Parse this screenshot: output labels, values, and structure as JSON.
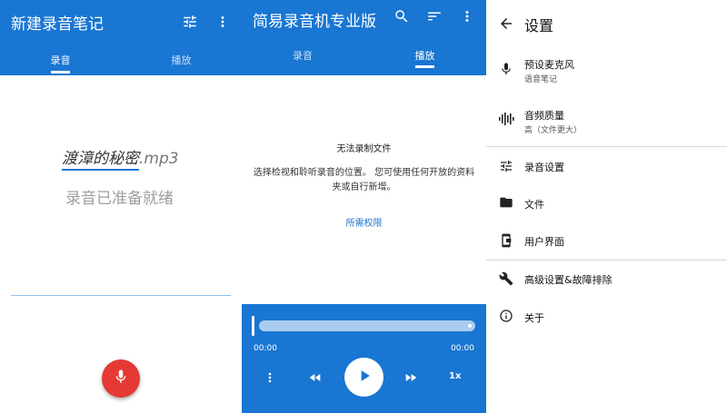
{
  "colors": {
    "primary": "#1976d2",
    "record_fab": "#e53935",
    "divider_accent": "#90c2ec"
  },
  "recorder": {
    "title": "新建录音笔记",
    "actions": [
      "tune-icon",
      "more-vert-icon"
    ],
    "tabs": [
      {
        "label": "录音",
        "active": true
      },
      {
        "label": "播放",
        "active": false
      }
    ],
    "filename_name": "渡漳的秘密",
    "filename_ext": ".mp3",
    "status": "录音已准备就绪",
    "fab_icon": "mic-icon"
  },
  "player_app": {
    "title": "简易录音机专业版",
    "actions": [
      "search-icon",
      "sort-icon",
      "more-vert-icon"
    ],
    "tabs": [
      {
        "label": "录音",
        "active": false
      },
      {
        "label": "播放",
        "active": true
      }
    ],
    "error_title": "无法录制文件",
    "error_desc": "选择检视和聆听录音的位置。 您可使用任何开放的资料夹或自行新增。",
    "permission_link": "所需权限",
    "player": {
      "time_start": "00:00",
      "time_end": "00:00",
      "speed": "1x",
      "progress": 0,
      "controls": [
        "more-vert-icon",
        "rewind-icon",
        "play-icon",
        "fast-forward-icon"
      ]
    }
  },
  "settings": {
    "title": "设置",
    "items": [
      {
        "icon": "mic-icon",
        "label": "预设麦克风",
        "sub": "语音笔记"
      },
      {
        "icon": "audio-wave-icon",
        "label": "音频质量",
        "sub": "高（文件更大）"
      },
      {
        "icon": "tune-icon",
        "label": "录音设置",
        "sub": ""
      },
      {
        "icon": "folder-icon",
        "label": "文件",
        "sub": ""
      },
      {
        "icon": "phone-ui-icon",
        "label": "用户界面",
        "sub": ""
      },
      {
        "icon": "wrench-icon",
        "label": "高级设置&故障排除",
        "sub": ""
      },
      {
        "icon": "info-icon",
        "label": "关于",
        "sub": ""
      }
    ]
  }
}
